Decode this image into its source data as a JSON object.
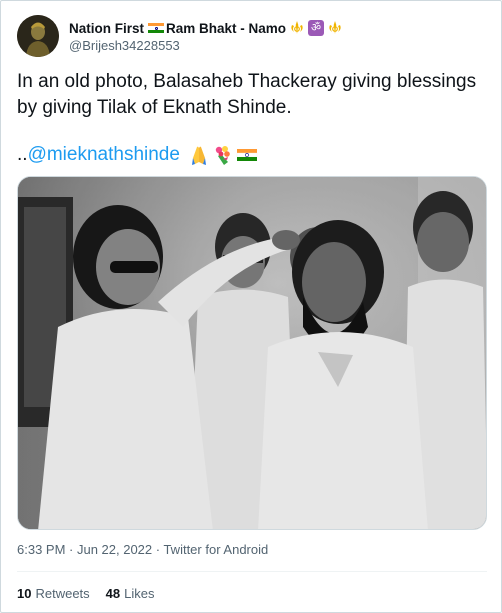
{
  "tweet": {
    "author": {
      "display_name_part1": "Nation First",
      "display_name_part2": "Ram Bhakt - Namo",
      "handle": "@Brijesh34228553",
      "avatar": "avatar-icon"
    },
    "text": "In an old photo, Balasaheb Thackeray giving blessings by giving Tilak of Eknath Shinde.",
    "mention_prefix": "..",
    "mention": "@mieknathshinde",
    "emojis": [
      "folded-hands-emoji",
      "bouquet-emoji",
      "india-flag-emoji"
    ],
    "timestamp": "6:33 PM · Jun 22, 2022 · Twitter for Android",
    "retweets_count": "10",
    "retweets_label": "Retweets",
    "likes_count": "48",
    "likes_label": "Likes"
  },
  "colors": {
    "link": "#1d9bf0",
    "text_primary": "#0f1419",
    "text_secondary": "#536471",
    "border": "#cfd9de"
  }
}
